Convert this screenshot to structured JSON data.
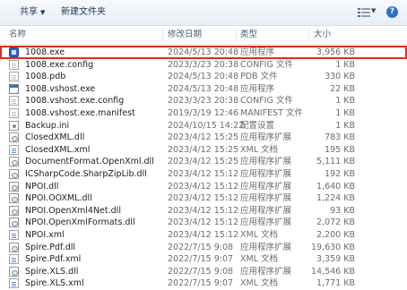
{
  "toolbar": {
    "share_label": "共享",
    "new_folder_label": "新建文件夹"
  },
  "columns": {
    "name": "名称",
    "date": "修改日期",
    "type": "类型",
    "size": "大小"
  },
  "files": [
    {
      "name": "1008.exe",
      "date": "2024/5/13 20:48",
      "type": "应用程序",
      "size": "3,956 KB",
      "icon": "exe",
      "selected": true
    },
    {
      "name": "1008.exe.config",
      "date": "2023/3/23 20:38",
      "type": "CONFIG 文件",
      "size": "1 KB",
      "icon": "doc"
    },
    {
      "name": "1008.pdb",
      "date": "2024/5/13 20:48",
      "type": "PDB 文件",
      "size": "330 KB",
      "icon": "doc"
    },
    {
      "name": "1008.vshost.exe",
      "date": "2024/5/13 20:48",
      "type": "应用程序",
      "size": "22 KB",
      "icon": "win"
    },
    {
      "name": "1008.vshost.exe.config",
      "date": "2023/3/23 20:38",
      "type": "CONFIG 文件",
      "size": "1 KB",
      "icon": "doc"
    },
    {
      "name": "1008.vshost.exe.manifest",
      "date": "2019/3/19 12:46",
      "type": "MANIFEST 文件",
      "size": "1 KB",
      "icon": "doc"
    },
    {
      "name": "Backup.ini",
      "date": "2024/10/15 14:22",
      "type": "配置设置",
      "size": "1 KB",
      "icon": "ini"
    },
    {
      "name": "ClosedXML.dll",
      "date": "2023/4/12 15:25",
      "type": "应用程序扩展",
      "size": "783 KB",
      "icon": "dll"
    },
    {
      "name": "ClosedXML.xml",
      "date": "2023/4/12 15:25",
      "type": "XML 文档",
      "size": "195 KB",
      "icon": "xml"
    },
    {
      "name": "DocumentFormat.OpenXml.dll",
      "date": "2023/4/12 15:25",
      "type": "应用程序扩展",
      "size": "5,111 KB",
      "icon": "dll"
    },
    {
      "name": "ICSharpCode.SharpZipLib.dll",
      "date": "2023/4/12 15:12",
      "type": "应用程序扩展",
      "size": "192 KB",
      "icon": "dll"
    },
    {
      "name": "NPOI.dll",
      "date": "2023/4/12 15:12",
      "type": "应用程序扩展",
      "size": "1,640 KB",
      "icon": "dll"
    },
    {
      "name": "NPOI.OOXML.dll",
      "date": "2023/4/12 15:12",
      "type": "应用程序扩展",
      "size": "1,224 KB",
      "icon": "dll"
    },
    {
      "name": "NPOI.OpenXml4Net.dll",
      "date": "2023/4/12 15:12",
      "type": "应用程序扩展",
      "size": "93 KB",
      "icon": "dll"
    },
    {
      "name": "NPOI.OpenXmlFormats.dll",
      "date": "2023/4/12 15:12",
      "type": "应用程序扩展",
      "size": "2,072 KB",
      "icon": "dll"
    },
    {
      "name": "NPOI.xml",
      "date": "2023/4/12 15:12",
      "type": "XML 文档",
      "size": "2,200 KB",
      "icon": "xml"
    },
    {
      "name": "Spire.Pdf.dll",
      "date": "2022/7/15 9:08",
      "type": "应用程序扩展",
      "size": "19,630 KB",
      "icon": "dll"
    },
    {
      "name": "Spire.Pdf.xml",
      "date": "2022/7/15 9:07",
      "type": "XML 文档",
      "size": "3,359 KB",
      "icon": "xml"
    },
    {
      "name": "Spire.XLS.dll",
      "date": "2022/7/15 9:08",
      "type": "应用程序扩展",
      "size": "14,546 KB",
      "icon": "dll"
    },
    {
      "name": "Spire.XLS.xml",
      "date": "2022/7/15 9:07",
      "type": "XML 文档",
      "size": "1,771 KB",
      "icon": "xml"
    }
  ]
}
